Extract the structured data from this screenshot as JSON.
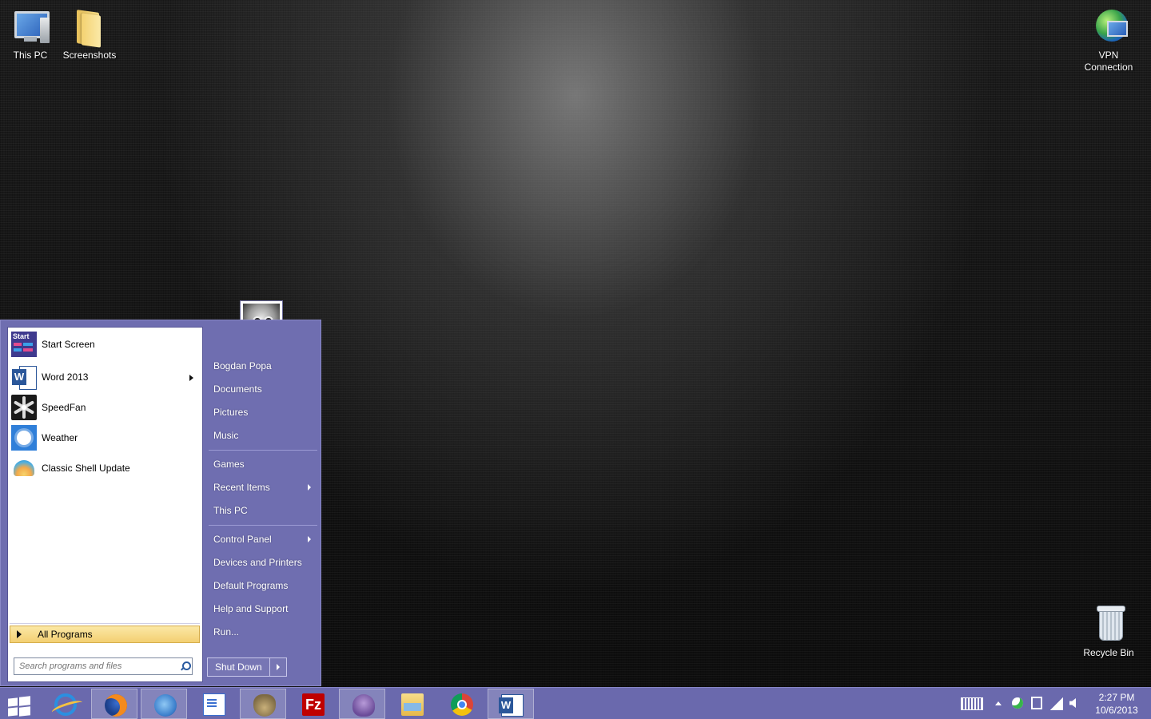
{
  "desktop": {
    "icons": {
      "this_pc": "This PC",
      "screenshots": "Screenshots",
      "vpn_line1": "VPN",
      "vpn_line2": "Connection",
      "recycle_bin": "Recycle Bin"
    }
  },
  "start_menu": {
    "programs": [
      {
        "label": "Start Screen",
        "icon": "start-screen-icon"
      },
      {
        "label": "Word 2013",
        "icon": "word-icon",
        "has_submenu": true
      },
      {
        "label": "SpeedFan",
        "icon": "speedfan-icon"
      },
      {
        "label": "Weather",
        "icon": "weather-icon"
      },
      {
        "label": "Classic Shell Update",
        "icon": "classic-shell-icon"
      }
    ],
    "all_programs": "All Programs",
    "search": {
      "placeholder": "Search programs and files",
      "value": ""
    },
    "right_items": [
      {
        "label": "Bogdan Popa"
      },
      {
        "label": "Documents"
      },
      {
        "label": "Pictures"
      },
      {
        "label": "Music"
      },
      {
        "label": "Games"
      },
      {
        "label": "Recent Items",
        "has_submenu": true
      },
      {
        "label": "This PC"
      },
      {
        "label": "Control Panel",
        "has_submenu": true
      },
      {
        "label": "Devices and Printers"
      },
      {
        "label": "Default Programs"
      },
      {
        "label": "Help and Support"
      },
      {
        "label": "Run..."
      }
    ],
    "shutdown_label": "Shut Down",
    "accent_color": "#6f6eb0"
  },
  "taskbar": {
    "pinned": [
      {
        "name": "internet-explorer-icon"
      },
      {
        "name": "firefox-icon",
        "active": true
      },
      {
        "name": "thunderbird-icon",
        "active": true
      },
      {
        "name": "document-icon"
      },
      {
        "name": "gimp-icon",
        "active": true
      },
      {
        "name": "filezilla-icon",
        "text": "Fz"
      },
      {
        "name": "pidgin-icon",
        "active": true
      },
      {
        "name": "file-explorer-icon"
      },
      {
        "name": "chrome-icon"
      },
      {
        "name": "word-icon",
        "active": true
      }
    ],
    "clock": {
      "time": "2:27 PM",
      "date": "10/6/2013"
    },
    "color": "#6a69ad"
  }
}
